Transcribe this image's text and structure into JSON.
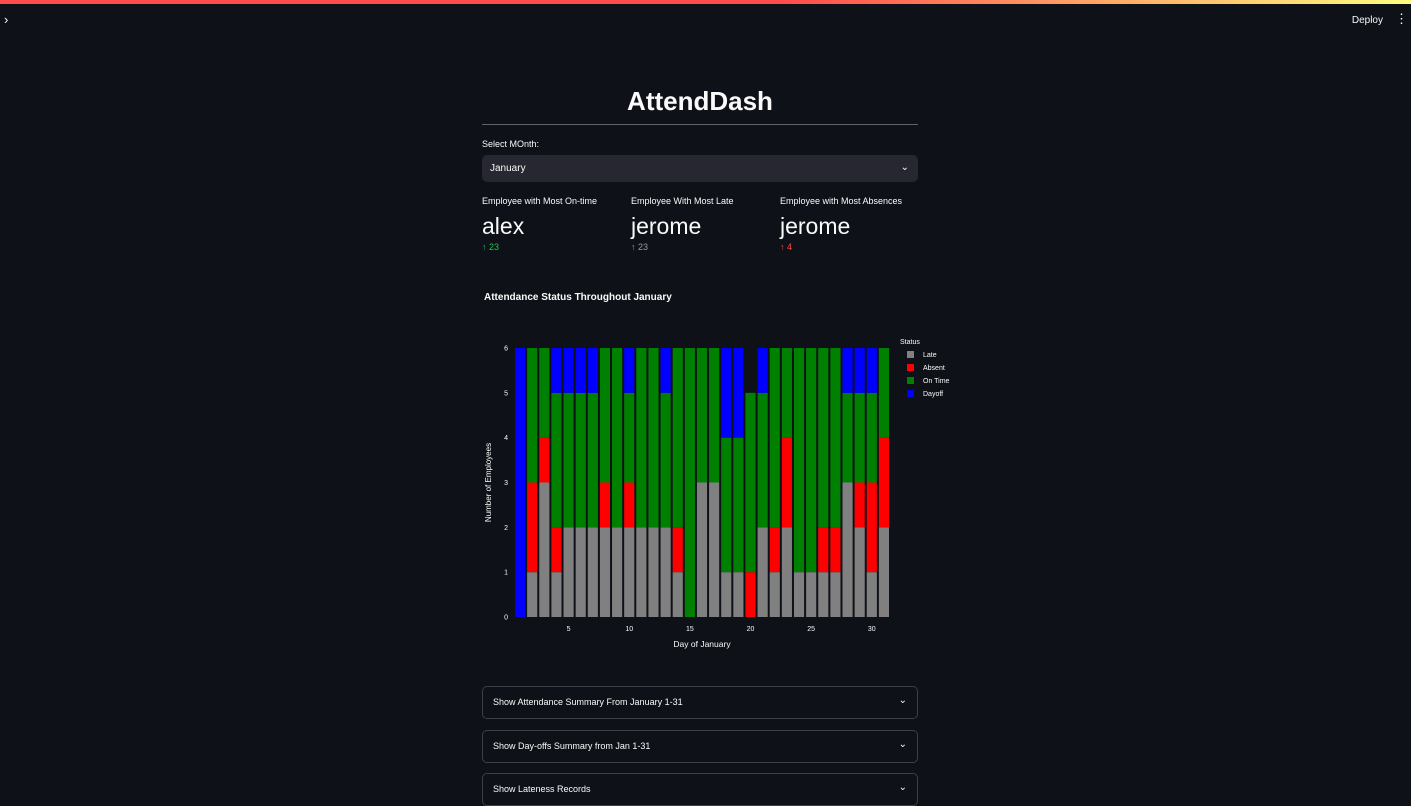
{
  "header": {
    "deploy_label": "Deploy",
    "sidebar_toggle": "›",
    "menu_icon": "⋮"
  },
  "page": {
    "title": "AttendDash"
  },
  "month_select": {
    "label": "Select MOnth:",
    "value": "January",
    "chevron": "⌄"
  },
  "metrics": [
    {
      "label": "Employee with Most On-time",
      "value": "alex",
      "delta": "↑ 23",
      "delta_color": "#21c354"
    },
    {
      "label": "Employee With Most Late",
      "value": "jerome",
      "delta": "↑ 23",
      "delta_color": "#9a9a9a"
    },
    {
      "label": "Employee with Most Absences",
      "value": "jerome",
      "delta": "↑ 4",
      "delta_color": "#ff4b4b"
    }
  ],
  "chart_title": "Attendance Status Throughout January",
  "chart_data": {
    "type": "bar",
    "stacked": true,
    "xlabel": "Day of January",
    "ylabel": "Number of Employees",
    "xticks": [
      5,
      10,
      15,
      20,
      25,
      30
    ],
    "yticks": [
      0,
      1,
      2,
      3,
      4,
      5,
      6
    ],
    "ylim": [
      0,
      6
    ],
    "grid": false,
    "legend_title": "Status",
    "legend_position": "top-right",
    "categories": [
      1,
      2,
      3,
      4,
      5,
      6,
      7,
      8,
      9,
      10,
      11,
      12,
      13,
      14,
      15,
      16,
      17,
      18,
      19,
      20,
      21,
      22,
      23,
      24,
      25,
      26,
      27,
      28,
      29,
      30,
      31
    ],
    "series": [
      {
        "name": "Late",
        "color": "#808080",
        "values": [
          0,
          1,
          3,
          1,
          2,
          2,
          2,
          2,
          2,
          2,
          2,
          2,
          2,
          1,
          0,
          3,
          3,
          1,
          1,
          0,
          2,
          1,
          2,
          1,
          1,
          1,
          1,
          3,
          2,
          1,
          2
        ]
      },
      {
        "name": "Absent",
        "color": "#ff0000",
        "values": [
          0,
          2,
          1,
          1,
          0,
          0,
          0,
          1,
          0,
          1,
          0,
          0,
          0,
          1,
          0,
          0,
          0,
          0,
          0,
          1,
          0,
          1,
          2,
          0,
          0,
          1,
          1,
          0,
          1,
          2,
          2
        ]
      },
      {
        "name": "On Time",
        "color": "#008000",
        "values": [
          0,
          3,
          2,
          3,
          3,
          3,
          3,
          3,
          4,
          2,
          4,
          4,
          3,
          4,
          6,
          3,
          3,
          3,
          3,
          4,
          3,
          4,
          2,
          5,
          5,
          4,
          4,
          2,
          2,
          2,
          2
        ]
      },
      {
        "name": "Dayoff",
        "color": "#0000ff",
        "values": [
          6,
          0,
          0,
          1,
          1,
          1,
          1,
          0,
          0,
          1,
          0,
          0,
          1,
          0,
          0,
          0,
          0,
          2,
          2,
          0,
          1,
          0,
          0,
          0,
          0,
          0,
          0,
          1,
          1,
          1,
          0
        ]
      }
    ]
  },
  "expanders": [
    {
      "label": "Show Attendance Summary From January 1-31"
    },
    {
      "label": "Show Day-offs Summary from Jan 1-31"
    },
    {
      "label": "Show Lateness Records"
    }
  ]
}
